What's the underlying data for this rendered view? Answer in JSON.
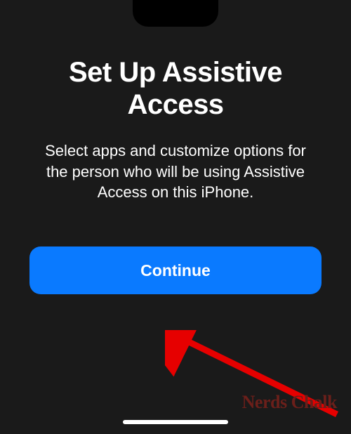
{
  "screen": {
    "title": "Set Up Assistive Access",
    "description": "Select apps and customize options for the person who will be using Assistive Access on this iPhone.",
    "continue_label": "Continue"
  },
  "watermark": "Nerds Chalk"
}
